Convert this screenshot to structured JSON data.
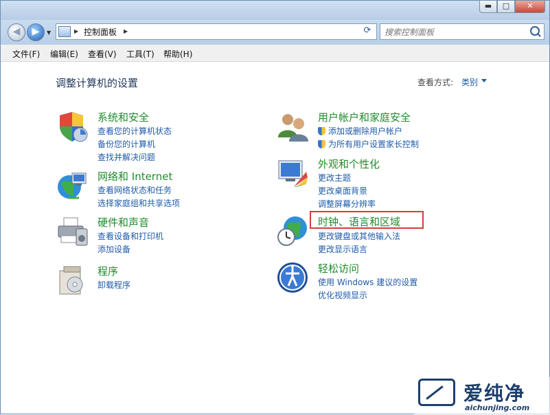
{
  "window": {
    "min": "▬",
    "max": "□",
    "close": "✕"
  },
  "nav": {
    "back_icon": "arrow-left",
    "forward_icon": "arrow-right",
    "dropdown": "▼"
  },
  "address": {
    "crumb": "控制面板",
    "sep": "▶",
    "dropdown": "▼"
  },
  "refresh": "⟳",
  "search": {
    "placeholder": "搜索控制面板"
  },
  "menu": [
    "文件(F)",
    "编辑(E)",
    "查看(V)",
    "工具(T)",
    "帮助(H)"
  ],
  "page": {
    "title": "调整计算机的设置",
    "view_label": "查看方式:",
    "view_value": "类别"
  },
  "categories": {
    "system": {
      "title": "系统和安全",
      "links": [
        "查看您的计算机状态",
        "备份您的计算机",
        "查找并解决问题"
      ]
    },
    "network": {
      "title": "网络和 Internet",
      "links": [
        "查看网络状态和任务",
        "选择家庭组和共享选项"
      ]
    },
    "hardware": {
      "title": "硬件和声音",
      "links": [
        "查看设备和打印机",
        "添加设备"
      ]
    },
    "programs": {
      "title": "程序",
      "links": [
        "卸载程序"
      ]
    },
    "users": {
      "title": "用户帐户和家庭安全",
      "links": [
        "添加或删除用户帐户",
        "为所有用户设置家长控制"
      ]
    },
    "appearance": {
      "title": "外观和个性化",
      "links": [
        "更改主题",
        "更改桌面背景",
        "调整屏幕分辨率"
      ]
    },
    "clock": {
      "title": "时钟、语言和区域",
      "links": [
        "更改键盘或其他输入法",
        "更改显示语言"
      ]
    },
    "ease": {
      "title": "轻松访问",
      "links": [
        "使用 Windows 建议的设置",
        "优化视频显示"
      ]
    }
  },
  "watermark": {
    "name": "爱纯净",
    "url": "aichunjing.com"
  },
  "colors": {
    "category_title": "#1f8b2c",
    "link": "#1e5aa8",
    "highlight_border": "#d43c3c"
  }
}
